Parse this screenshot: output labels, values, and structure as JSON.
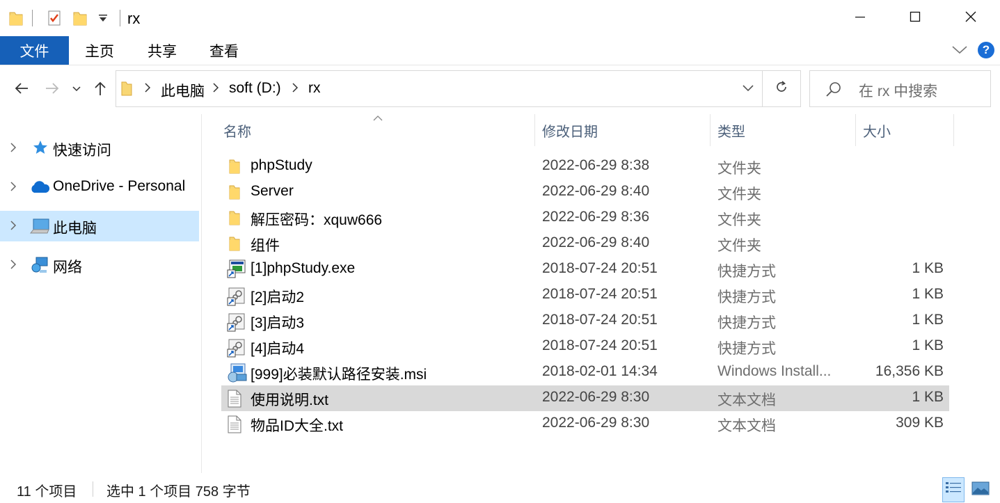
{
  "window": {
    "title": "rx"
  },
  "ribbon": {
    "tabs": [
      "文件",
      "主页",
      "共享",
      "查看"
    ],
    "help_label": "?"
  },
  "address": {
    "crumbs": [
      "此电脑",
      "soft (D:)",
      "rx"
    ],
    "search_placeholder": "在 rx 中搜索"
  },
  "nav_pane": {
    "items": [
      {
        "label": "快速访问",
        "icon": "star-icon"
      },
      {
        "label": "OneDrive - Personal",
        "icon": "cloud-icon"
      },
      {
        "label": "此电脑",
        "icon": "computer-icon",
        "selected": true
      },
      {
        "label": "网络",
        "icon": "network-icon"
      }
    ]
  },
  "columns": {
    "name": "名称",
    "date": "修改日期",
    "type": "类型",
    "size": "大小"
  },
  "files": [
    {
      "name": "phpStudy",
      "date": "2022-06-29 8:38",
      "type": "文件夹",
      "size": "",
      "icon": "folder-icon"
    },
    {
      "name": "Server",
      "date": "2022-06-29 8:40",
      "type": "文件夹",
      "size": "",
      "icon": "folder-icon"
    },
    {
      "name": "解压密码：xquw666",
      "date": "2022-06-29 8:36",
      "type": "文件夹",
      "size": "",
      "icon": "folder-icon"
    },
    {
      "name": "组件",
      "date": "2022-06-29 8:40",
      "type": "文件夹",
      "size": "",
      "icon": "folder-icon"
    },
    {
      "name": "[1]phpStudy.exe",
      "date": "2018-07-24 20:51",
      "type": "快捷方式",
      "size": "1 KB",
      "icon": "exe-shortcut-icon"
    },
    {
      "name": "[2]启动2",
      "date": "2018-07-24 20:51",
      "type": "快捷方式",
      "size": "1 KB",
      "icon": "shortcut-icon"
    },
    {
      "name": "[3]启动3",
      "date": "2018-07-24 20:51",
      "type": "快捷方式",
      "size": "1 KB",
      "icon": "shortcut-icon"
    },
    {
      "name": "[4]启动4",
      "date": "2018-07-24 20:51",
      "type": "快捷方式",
      "size": "1 KB",
      "icon": "shortcut-icon"
    },
    {
      "name": "[999]必装默认路径安装.msi",
      "date": "2018-02-01 14:34",
      "type": "Windows Install...",
      "size": "16,356 KB",
      "icon": "msi-icon"
    },
    {
      "name": "使用说明.txt",
      "date": "2022-06-29 8:30",
      "type": "文本文档",
      "size": "1 KB",
      "icon": "text-file-icon",
      "selected": true
    },
    {
      "name": "物品ID大全.txt",
      "date": "2022-06-29 8:30",
      "type": "文本文档",
      "size": "309 KB",
      "icon": "text-file-icon"
    }
  ],
  "status": {
    "count": "11 个项目",
    "selection": "选中 1 个项目  758 字节"
  },
  "colors": {
    "file_tab": "#1660b8",
    "selected_nav": "#cce8ff",
    "selected_row": "#d9d9d9",
    "folder": "#f8d775"
  }
}
